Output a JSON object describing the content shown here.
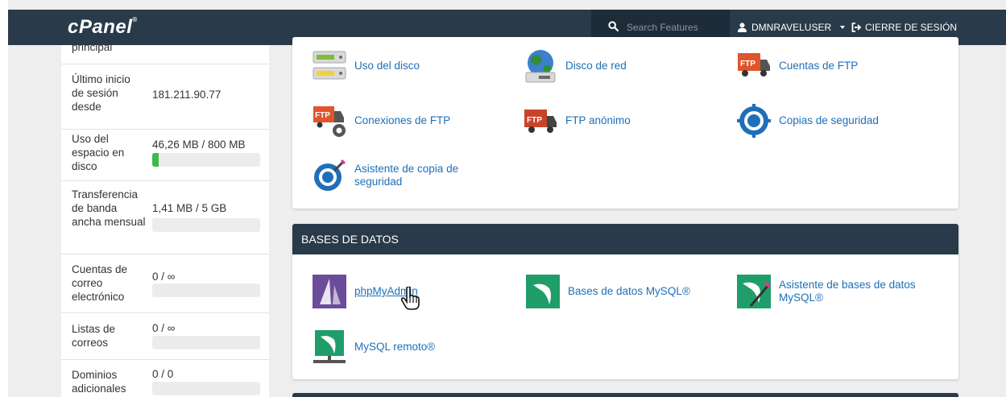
{
  "brand": {
    "name": "cPanel",
    "mark": "®"
  },
  "header": {
    "search_placeholder": "Search Features",
    "username": "DMNRAVELUSER",
    "logout": "CIERRE DE SESIÓN"
  },
  "stats": [
    {
      "label": "principal",
      "value": ""
    },
    {
      "label": "Último inicio de sesión desde",
      "value": "181.211.90.77"
    },
    {
      "label": "Uso del espacio en disco",
      "value": "46,26 MB / 800 MB",
      "usage_percent": 5.8
    },
    {
      "label": "Transferencia de banda ancha mensual",
      "value": "1,41 MB / 5 GB",
      "usage_percent": 0
    },
    {
      "label": "Cuentas de correo electrónico",
      "value": "0 / ∞",
      "usage_percent": 0
    },
    {
      "label": "Listas de correos",
      "value": "0 / ∞",
      "usage_percent": 0
    },
    {
      "label": "Dominios adicionales",
      "value": "0 / 0",
      "usage_percent": 0
    }
  ],
  "files_section": {
    "items": [
      {
        "label": "Uso del disco",
        "icon": "disk-usage-icon"
      },
      {
        "label": "Disco de red",
        "icon": "network-disk-icon"
      },
      {
        "label": "Cuentas de FTP",
        "icon": "ftp-accounts-icon"
      },
      {
        "label": "Conexiones de FTP",
        "icon": "ftp-connections-icon"
      },
      {
        "label": "FTP anónimo",
        "icon": "anonymous-ftp-icon"
      },
      {
        "label": "Copias de seguridad",
        "icon": "backup-icon"
      },
      {
        "label": "Asistente de copia de seguridad",
        "icon": "backup-wizard-icon"
      }
    ]
  },
  "databases_section": {
    "title": "BASES DE DATOS",
    "items": [
      {
        "label": "phpMyAdmin",
        "icon": "phpmyadmin-icon"
      },
      {
        "label": "Bases de datos MySQL®",
        "icon": "mysql-databases-icon"
      },
      {
        "label": "Asistente de bases de datos MySQL®",
        "icon": "mysql-wizard-icon"
      },
      {
        "label": "MySQL remoto®",
        "icon": "remote-mysql-icon"
      }
    ]
  },
  "colors": {
    "topbar": "#293a4a",
    "link": "#1e6fb8",
    "usage_bar": "#3dba48",
    "mysql_green": "#1f9e6a"
  }
}
